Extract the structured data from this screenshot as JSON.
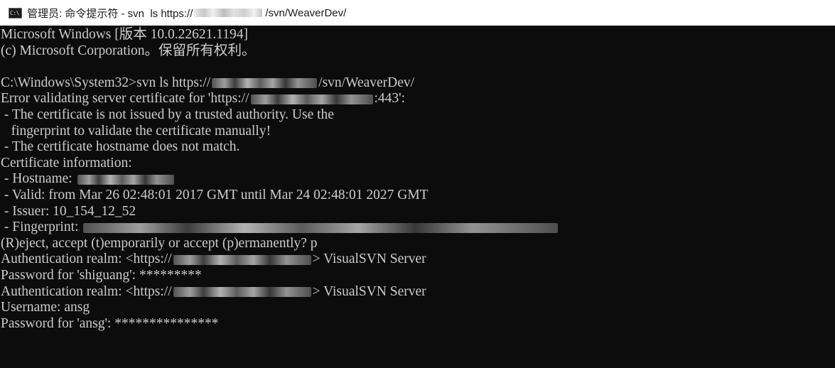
{
  "window": {
    "title_prefix": "管理员: 命令提示符 - svn  ls https://",
    "title_suffix": "/svn/WeaverDev/",
    "icon": "cmd-prompt-icon"
  },
  "console": {
    "lines": {
      "l1": "Microsoft Windows [版本 10.0.22621.1194]",
      "l2": "(c) Microsoft Corporation。保留所有权利。",
      "l4a": "C:\\Windows\\System32>svn ls https://",
      "l4b": "/svn/WeaverDev/",
      "l5a": "Error validating server certificate for 'https://",
      "l5b": ":443':",
      "l6": " - The certificate is not issued by a trusted authority. Use the",
      "l7": "   fingerprint to validate the certificate manually!",
      "l8": " - The certificate hostname does not match.",
      "l9": "Certificate information:",
      "l10": " - Hostname: ",
      "l11": " - Valid: from Mar 26 02:48:01 2017 GMT until Mar 24 02:48:01 2027 GMT",
      "l12": " - Issuer: 10_154_12_52",
      "l13": " - Fingerprint: ",
      "l14": "(R)eject, accept (t)emporarily or accept (p)ermanently? p",
      "l15a": "Authentication realm: <https://",
      "l15b": "> VisualSVN Server",
      "l16": "Password for 'shiguang': *********",
      "l17a": "Authentication realm: <https://",
      "l17b": "> VisualSVN Server",
      "l18": "Username: ansg",
      "l19": "Password for 'ansg': ***************"
    }
  },
  "colors": {
    "background": "#0c0c0c",
    "foreground": "#cccccc",
    "titlebar": "#ffffff"
  }
}
